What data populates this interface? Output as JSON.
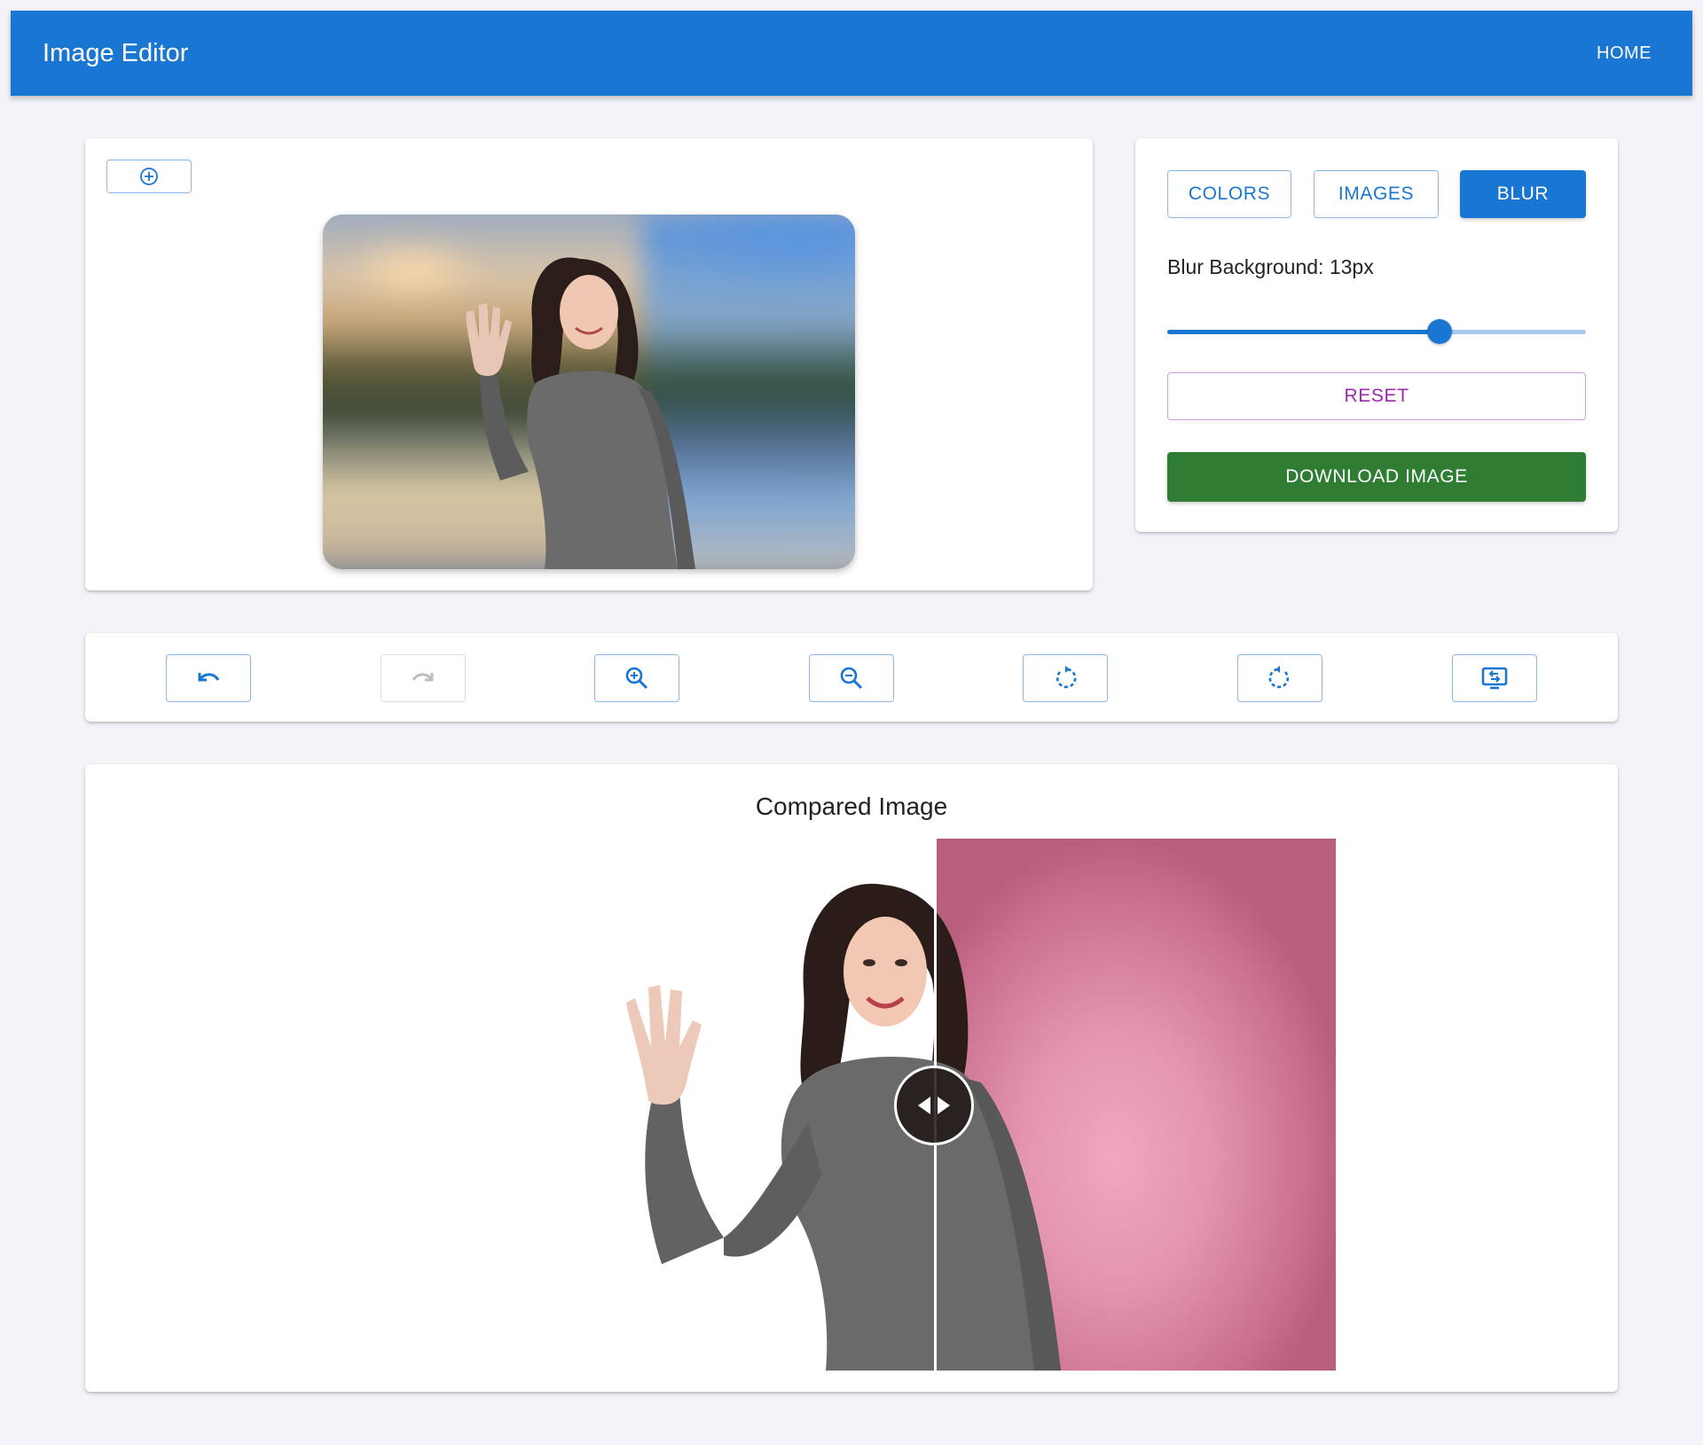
{
  "appbar": {
    "title": "Image Editor",
    "home_label": "HOME"
  },
  "editor": {
    "add_icon": "plus-circle-icon",
    "image_alt": "Edited image with blurred background"
  },
  "panel": {
    "tabs": [
      {
        "label": "COLORS",
        "active": false
      },
      {
        "label": "IMAGES",
        "active": false
      },
      {
        "label": "BLUR",
        "active": true
      }
    ],
    "blur_label": "Blur Background: 13px",
    "blur_value_fraction": 0.65,
    "reset_label": "RESET",
    "download_label": "DOWNLOAD IMAGE"
  },
  "toolbar": {
    "buttons": [
      {
        "icon": "undo-icon",
        "enabled": true
      },
      {
        "icon": "redo-icon",
        "enabled": false
      },
      {
        "icon": "zoom-in-icon",
        "enabled": true
      },
      {
        "icon": "zoom-out-icon",
        "enabled": true
      },
      {
        "icon": "rotate-left-icon",
        "enabled": true
      },
      {
        "icon": "rotate-right-icon",
        "enabled": true
      },
      {
        "icon": "swap-screen-icon",
        "enabled": true
      }
    ]
  },
  "compare": {
    "title": "Compared Image",
    "handle_icon": "left-right-arrows-icon"
  },
  "colors": {
    "primary": "#1976d2",
    "download": "#2e7d32",
    "reset": "#9c27b0",
    "page_bg": "#f4f4f8"
  }
}
